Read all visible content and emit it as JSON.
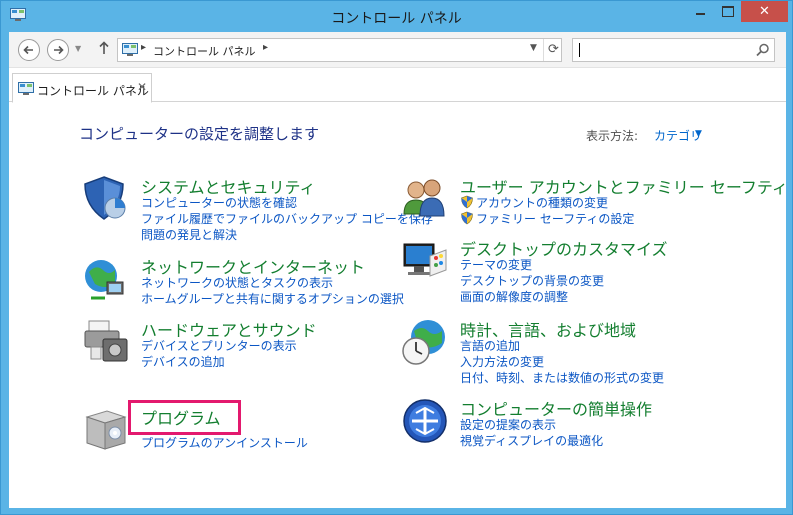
{
  "window": {
    "title": "コントロール パネル",
    "close_symbol": "✕",
    "accent": "#5ab4e6"
  },
  "nav": {
    "back_icon": "arrow-left-icon",
    "forward_icon": "arrow-right-icon",
    "up_icon": "arrow-up-icon",
    "address_path": "コントロール パネル",
    "address_sep": "▸",
    "refresh_symbol": "⟳",
    "search_value": ""
  },
  "tab": {
    "label": "コントロール パネル",
    "close_symbol": "✕"
  },
  "main": {
    "heading": "コンピューターの設定を調整します",
    "view_by_label": "表示方法:",
    "view_by_value": "カテゴリ"
  },
  "categories": [
    {
      "title": "システムとセキュリティ",
      "icon": "shield-security-icon",
      "links": [
        "コンピューターの状態を確認",
        "ファイル履歴でファイルのバックアップ コピーを保存",
        "問題の発見と解決"
      ]
    },
    {
      "title": "ネットワークとインターネット",
      "icon": "network-globe-icon",
      "links": [
        "ネットワークの状態とタスクの表示",
        "ホームグループと共有に関するオプションの選択"
      ]
    },
    {
      "title": "ハードウェアとサウンド",
      "icon": "printer-hardware-icon",
      "links": [
        "デバイスとプリンターの表示",
        "デバイスの追加"
      ]
    },
    {
      "title": "プログラム",
      "icon": "programs-box-icon",
      "links": [
        "プログラムのアンインストール"
      ]
    },
    {
      "title": "ユーザー アカウントとファミリー セーフティ",
      "icon": "users-icon",
      "links": [
        "アカウントの種類の変更",
        "ファミリー セーフティの設定"
      ]
    },
    {
      "title": "デスクトップのカスタマイズ",
      "icon": "monitor-palette-icon",
      "links": [
        "テーマの変更",
        "デスクトップの背景の変更",
        "画面の解像度の調整"
      ]
    },
    {
      "title": "時計、言語、および地域",
      "icon": "clock-globe-icon",
      "links": [
        "言語の追加",
        "入力方法の変更",
        "日付、時刻、または数値の形式の変更"
      ]
    },
    {
      "title": "コンピューターの簡単操作",
      "icon": "ease-of-access-icon",
      "links": [
        "設定の提案の表示",
        "視覚ディスプレイの最適化"
      ]
    }
  ]
}
